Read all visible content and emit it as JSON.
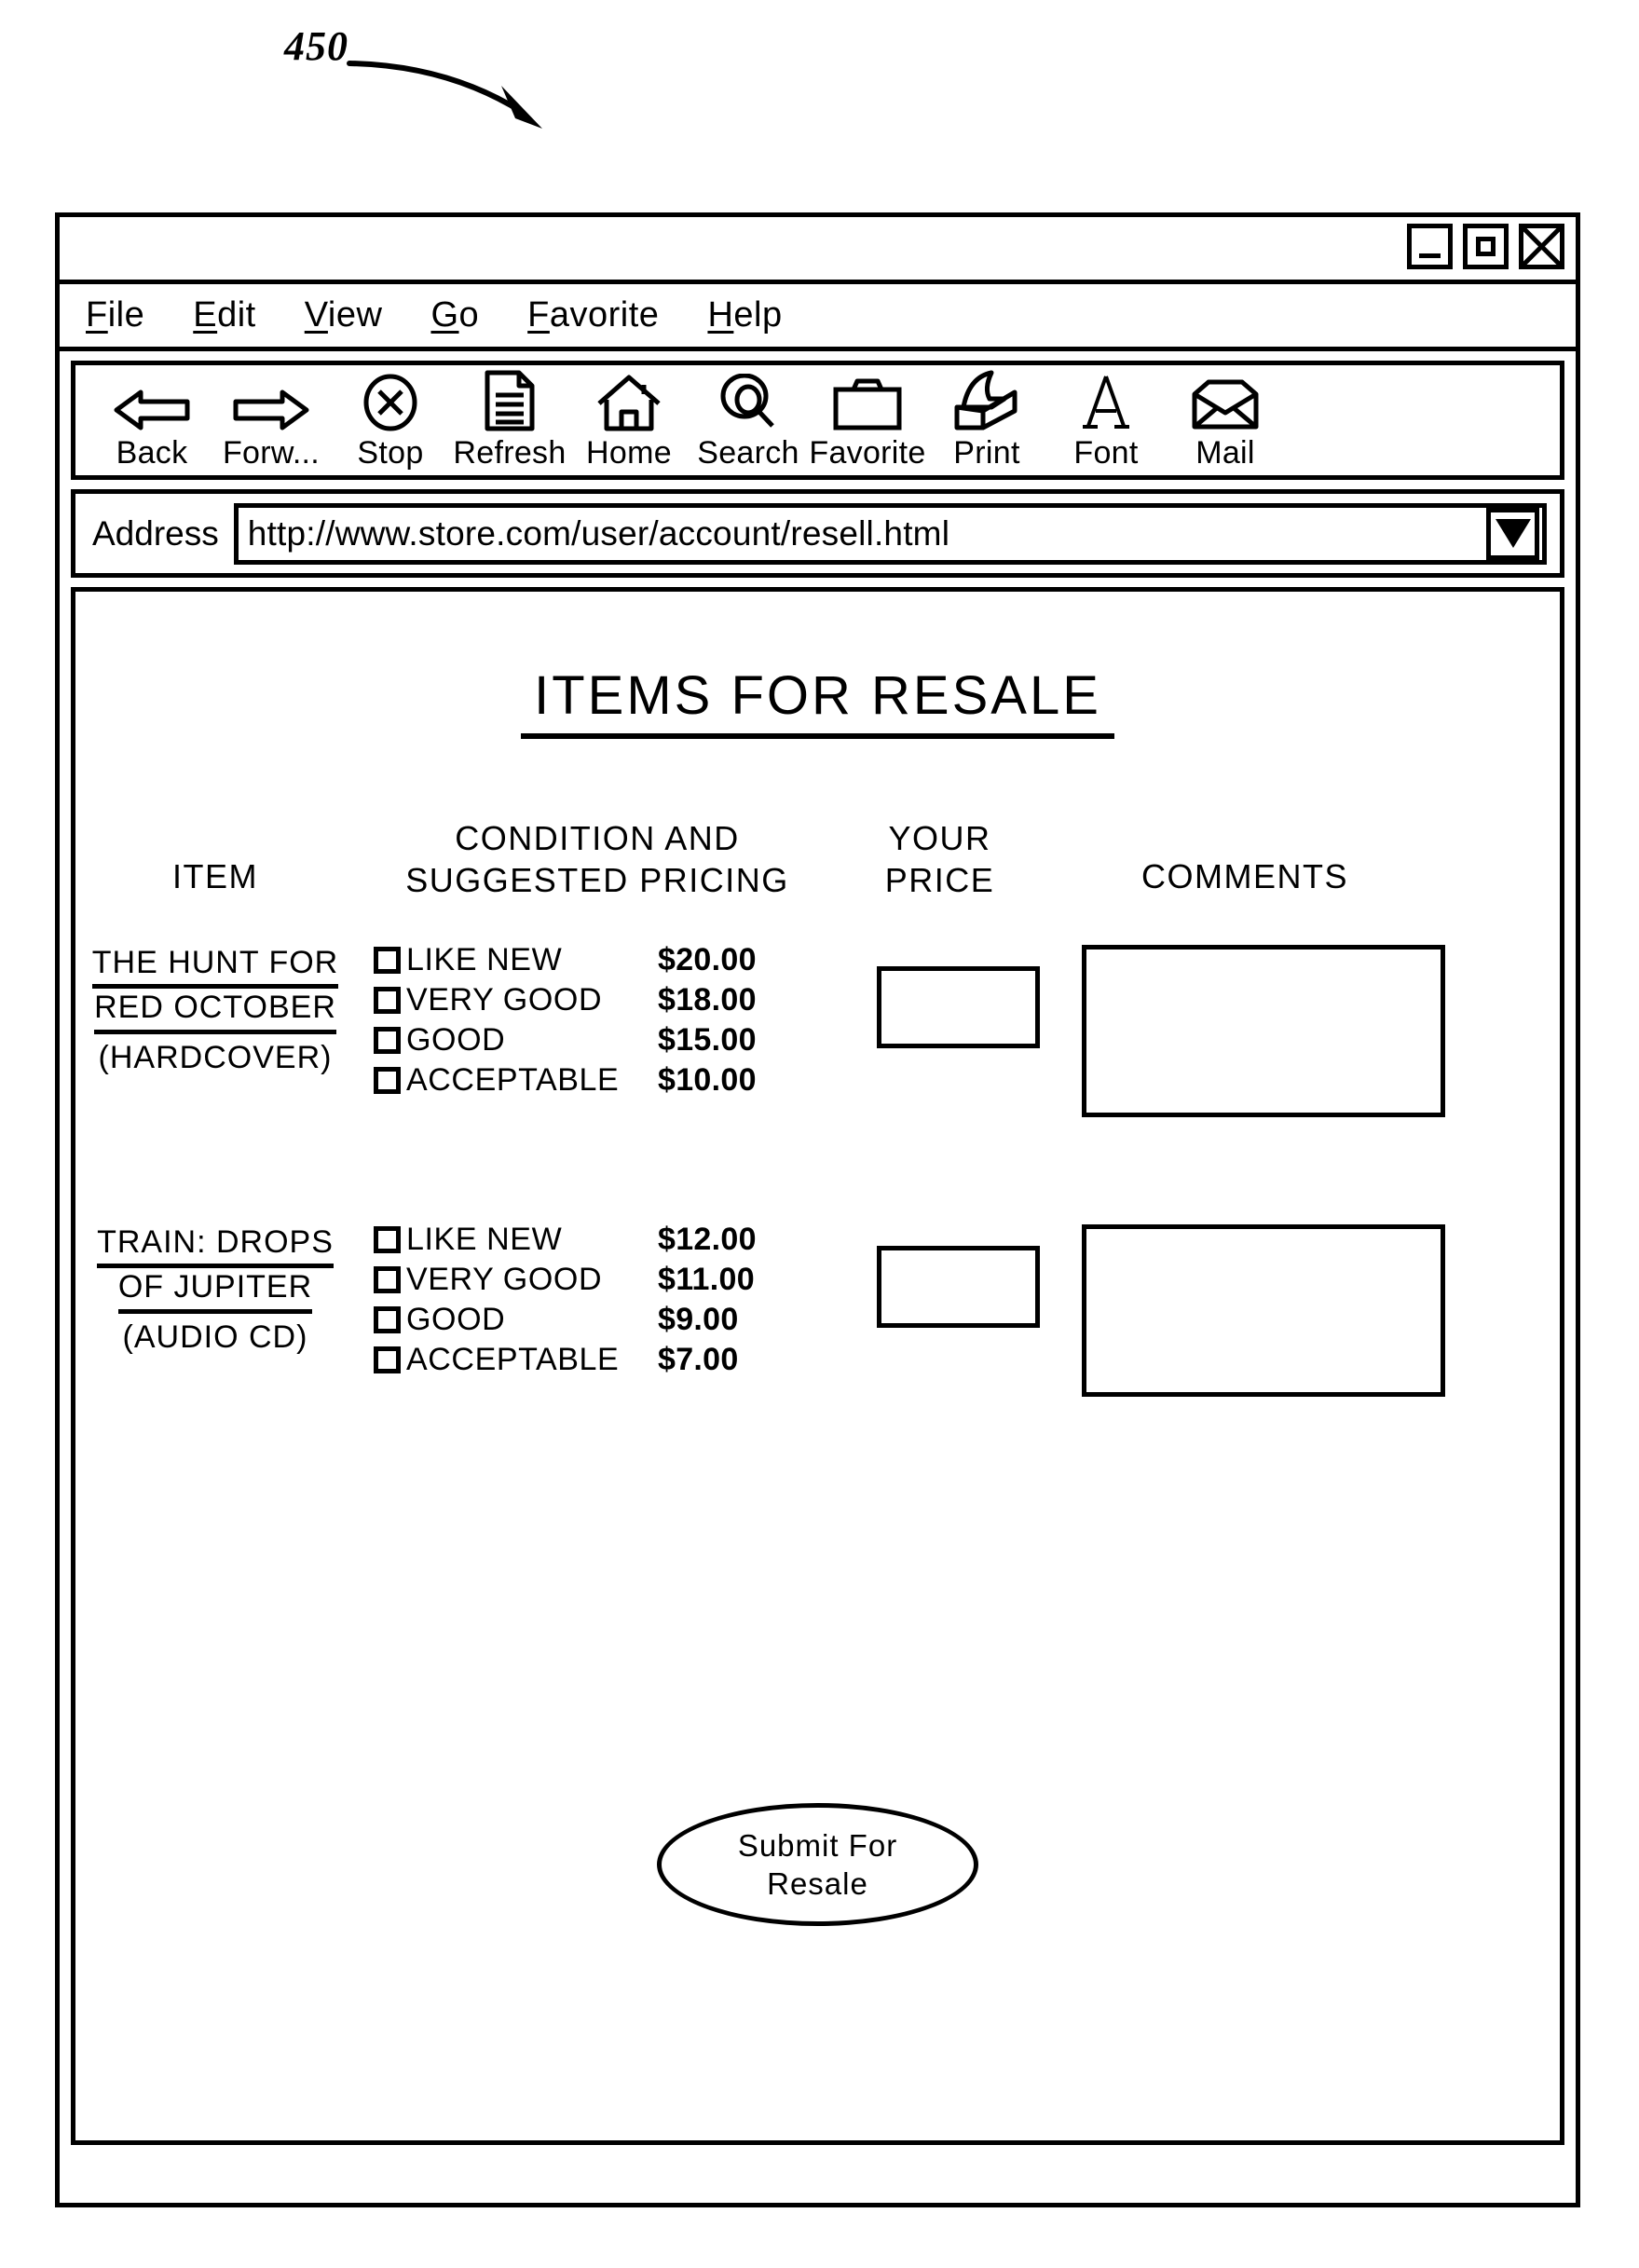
{
  "figure": {
    "reference_number": "450"
  },
  "window": {
    "controls": [
      {
        "name": "minimize",
        "label": "Minimize"
      },
      {
        "name": "maximize",
        "label": "Maximize"
      },
      {
        "name": "close",
        "label": "Close"
      }
    ]
  },
  "menu": {
    "items": [
      {
        "mnemonic": "F",
        "rest": "ile",
        "label": "File"
      },
      {
        "mnemonic": "E",
        "rest": "dit",
        "label": "Edit"
      },
      {
        "mnemonic": "V",
        "rest": "iew",
        "label": "View"
      },
      {
        "mnemonic": "G",
        "rest": "o",
        "label": "Go"
      },
      {
        "mnemonic": "F",
        "rest": "avorite",
        "label": "Favorite"
      },
      {
        "mnemonic": "H",
        "rest": "elp",
        "label": "Help"
      }
    ]
  },
  "toolbar": {
    "buttons": [
      {
        "label": "Back",
        "icon": "arrow-left-icon"
      },
      {
        "label": "Forw...",
        "icon": "arrow-right-icon"
      },
      {
        "label": "Stop",
        "icon": "stop-x-circle-icon"
      },
      {
        "label": "Refresh",
        "icon": "document-page-icon"
      },
      {
        "label": "Home",
        "icon": "house-icon"
      },
      {
        "label": "Search",
        "icon": "magnifier-icon"
      },
      {
        "label": "Favorite",
        "icon": "folder-icon"
      },
      {
        "label": "Print",
        "icon": "printer-icon"
      },
      {
        "label": "Font",
        "icon": "letter-a-icon"
      },
      {
        "label": "Mail",
        "icon": "envelope-icon"
      }
    ]
  },
  "address": {
    "label": "Address",
    "url": "http://www.store.com/user/account/resell.html",
    "dropdown_icon": "chevron-down-icon"
  },
  "page": {
    "title": "ITEMS FOR RESALE",
    "columns": [
      "ITEM",
      "CONDITION AND\nSUGGESTED PRICING",
      "YOUR\nPRICE",
      "COMMENTS"
    ],
    "column_headers": {
      "item": "ITEM",
      "condition_line1": "CONDITION AND",
      "condition_line2": "SUGGESTED PRICING",
      "price_line1": "YOUR",
      "price_line2": "PRICE",
      "comments": "COMMENTS"
    },
    "rows": [
      {
        "title_line1": "THE HUNT FOR",
        "title_line2": "RED OCTOBER",
        "format": "(HARDCOVER)",
        "conditions": [
          {
            "label": "LIKE NEW",
            "price": "$20.00",
            "checked": false
          },
          {
            "label": "VERY GOOD",
            "price": "$18.00",
            "checked": false
          },
          {
            "label": "GOOD",
            "price": "$15.00",
            "checked": false
          },
          {
            "label": "ACCEPTABLE",
            "price": "$10.00",
            "checked": false
          }
        ],
        "your_price": "",
        "your_price_placeholder": "",
        "comments": "",
        "comments_placeholder": ""
      },
      {
        "title_line1": "TRAIN: DROPS",
        "title_line2": "OF JUPITER",
        "format": "(AUDIO CD)",
        "conditions": [
          {
            "label": "LIKE NEW",
            "price": "$12.00",
            "checked": false
          },
          {
            "label": "VERY GOOD",
            "price": "$11.00",
            "checked": false
          },
          {
            "label": "GOOD",
            "price": "$9.00",
            "checked": false
          },
          {
            "label": "ACCEPTABLE",
            "price": "$7.00",
            "checked": false
          }
        ],
        "your_price": "",
        "your_price_placeholder": "",
        "comments": "",
        "comments_placeholder": ""
      }
    ],
    "submit": {
      "line1": "Submit For",
      "line2": "Resale"
    }
  },
  "colors": {
    "ink": "#000000",
    "paper": "#ffffff"
  }
}
